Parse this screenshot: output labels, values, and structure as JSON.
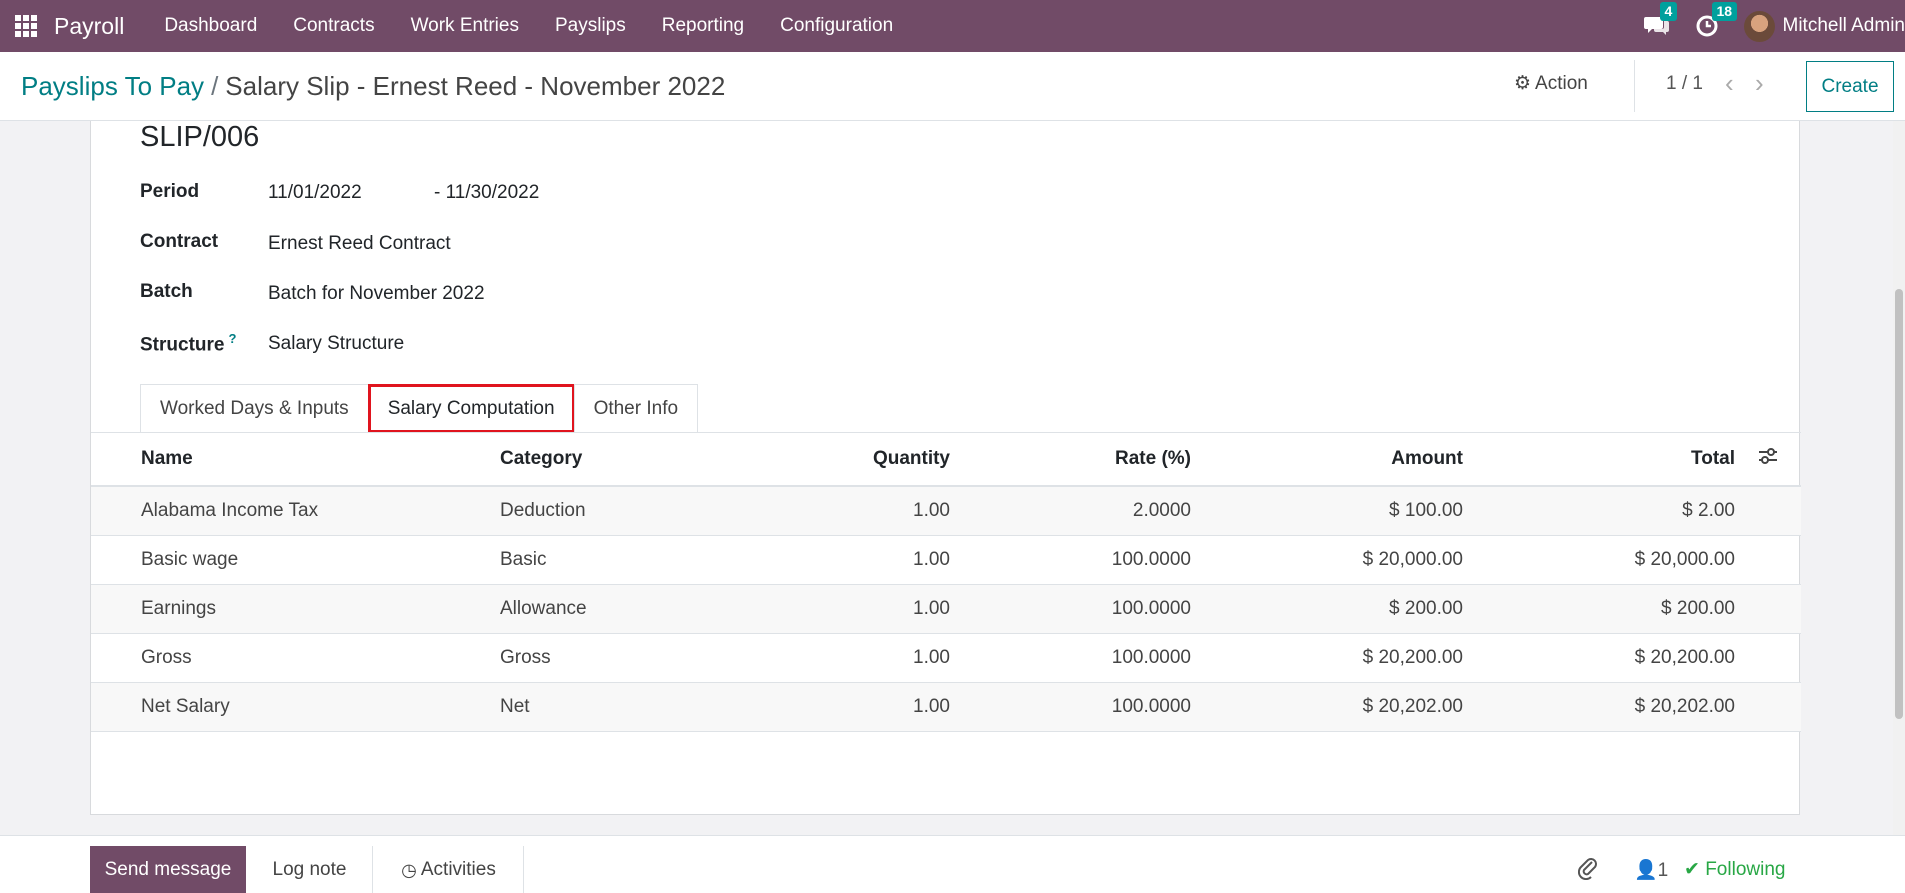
{
  "navbar": {
    "app_name": "Payroll",
    "menu": [
      "Dashboard",
      "Contracts",
      "Work Entries",
      "Payslips",
      "Reporting",
      "Configuration"
    ],
    "messages_count": "4",
    "activities_count": "18",
    "user_name": "Mitchell Admin",
    "icons": {
      "apps": "apps-grid-icon",
      "messages": "chat-bubbles-icon",
      "activities": "clock-icon"
    }
  },
  "control_panel": {
    "breadcrumb_parent": "Payslips To Pay",
    "breadcrumb_separator": "/",
    "breadcrumb_current": "Salary Slip - Ernest Reed - November 2022",
    "action_label": "Action",
    "pager": "1 / 1",
    "create_label": "Create"
  },
  "form": {
    "slip_number": "SLIP/006",
    "period_label": "Period",
    "period_from": "11/01/2022",
    "period_to": "- 11/30/2022",
    "contract_label": "Contract",
    "contract_value": "Ernest Reed Contract",
    "batch_label": "Batch",
    "batch_value": "Batch for November 2022",
    "structure_label": "Structure",
    "structure_help": "?",
    "structure_value": "Salary Structure"
  },
  "tabs": [
    {
      "label": "Worked Days & Inputs",
      "active": false
    },
    {
      "label": "Salary Computation",
      "active": true
    },
    {
      "label": "Other Info",
      "active": false
    }
  ],
  "table": {
    "headers": [
      "Name",
      "Category",
      "Quantity",
      "Rate (%)",
      "Amount",
      "Total"
    ],
    "rows": [
      [
        "Alabama Income Tax",
        "Deduction",
        "1.00",
        "2.0000",
        "$ 100.00",
        "$ 2.00"
      ],
      [
        "Basic wage",
        "Basic",
        "1.00",
        "100.0000",
        "$ 20,000.00",
        "$ 20,000.00"
      ],
      [
        "Earnings",
        "Allowance",
        "1.00",
        "100.0000",
        "$ 200.00",
        "$ 200.00"
      ],
      [
        "Gross",
        "Gross",
        "1.00",
        "100.0000",
        "$ 20,200.00",
        "$ 20,200.00"
      ],
      [
        "Net Salary",
        "Net",
        "1.00",
        "100.0000",
        "$ 20,202.00",
        "$ 20,202.00"
      ]
    ]
  },
  "chatter": {
    "send_message": "Send message",
    "log_note": "Log note",
    "activities": "Activities",
    "followers_count": "1",
    "following": "Following"
  },
  "colors": {
    "brand": "#714b67",
    "accent": "#017e84",
    "highlight": "#e0141e",
    "following": "#28a745"
  }
}
